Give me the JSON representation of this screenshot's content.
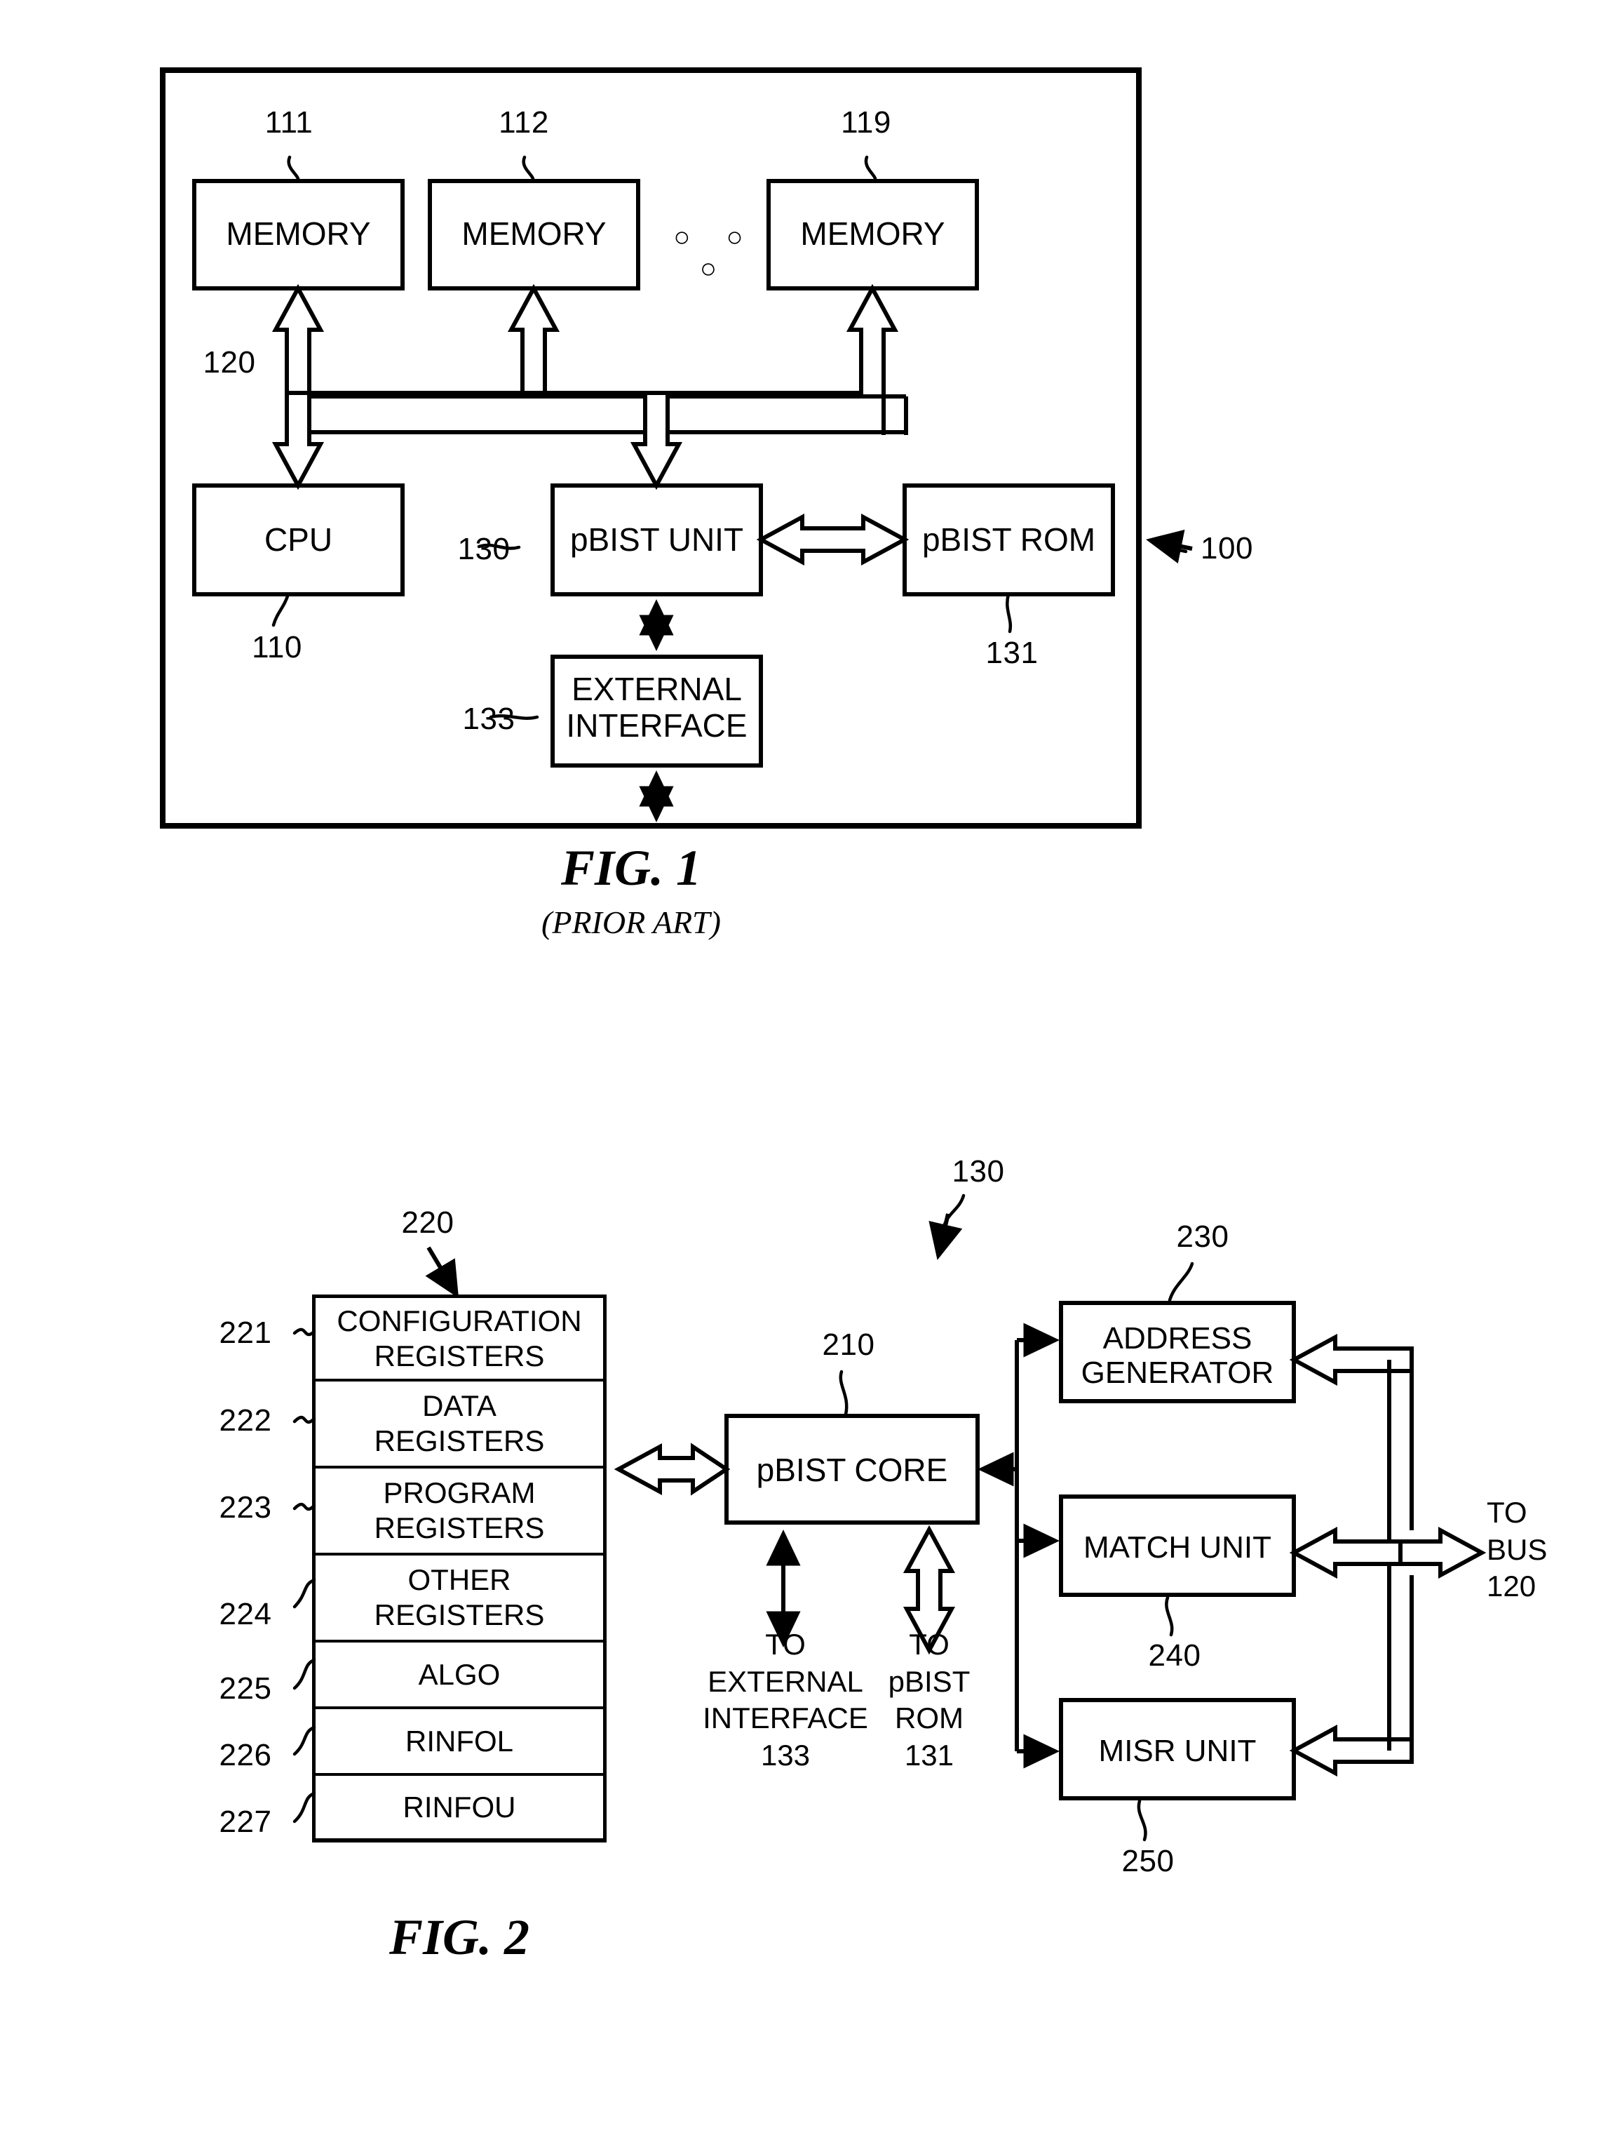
{
  "figure1": {
    "caption": "FIG. 1",
    "subcaption": "(PRIOR ART)",
    "system_ref": "100",
    "bus_ref": "120",
    "blocks": {
      "memory1": {
        "label": "MEMORY",
        "ref": "111"
      },
      "memory2": {
        "label": "MEMORY",
        "ref": "112"
      },
      "memory3": {
        "label": "MEMORY",
        "ref": "119"
      },
      "cpu": {
        "label": "CPU",
        "ref": "110"
      },
      "pbist_unit": {
        "label": "pBIST UNIT",
        "ref": "130"
      },
      "pbist_rom": {
        "label": "pBIST ROM",
        "ref": "131"
      },
      "external_interface": {
        "label": "EXTERNAL\nINTERFACE",
        "ref": "133"
      }
    },
    "ellipsis": "○  ○  ○"
  },
  "figure2": {
    "caption": "FIG. 2",
    "unit_ref": "130",
    "registers_ref": "220",
    "core": {
      "label": "pBIST CORE",
      "ref": "210"
    },
    "registers": [
      {
        "label": "CONFIGURATION\nREGISTERS",
        "ref": "221"
      },
      {
        "label": "DATA\nREGISTERS",
        "ref": "222"
      },
      {
        "label": "PROGRAM\nREGISTERS",
        "ref": "223"
      },
      {
        "label": "OTHER\nREGISTERS",
        "ref": "224"
      },
      {
        "label": "ALGO",
        "ref": "225"
      },
      {
        "label": "RINFOL",
        "ref": "226"
      },
      {
        "label": "RINFOU",
        "ref": "227"
      }
    ],
    "units": [
      {
        "label": "ADDRESS\nGENERATOR",
        "ref": "230"
      },
      {
        "label": "MATCH UNIT",
        "ref": "240"
      },
      {
        "label": "MISR UNIT",
        "ref": "250"
      }
    ],
    "port_external": "TO\nEXTERNAL\nINTERFACE\n133",
    "port_rom": "TO\npBIST\nROM\n131",
    "port_bus": "TO\nBUS\n120"
  }
}
